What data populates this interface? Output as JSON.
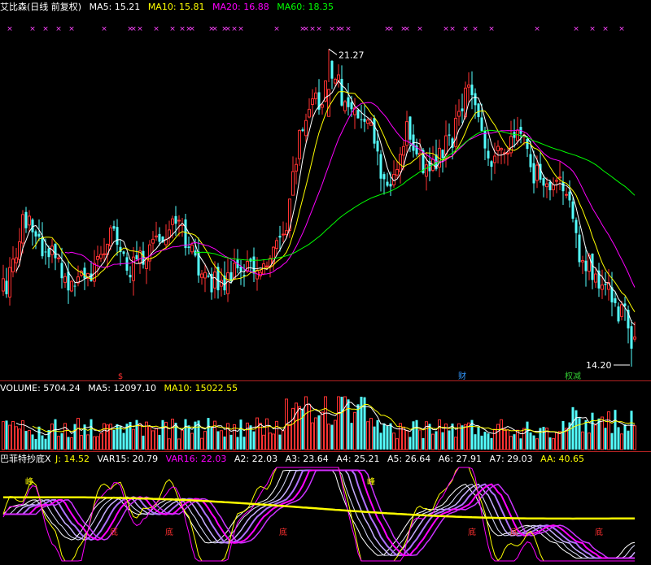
{
  "price_panel": {
    "title": "艾比森(日线 前复权)",
    "ma_labels": [
      {
        "text": "MA5: 15.21",
        "color": "#ffffff"
      },
      {
        "text": "MA10: 15.81",
        "color": "#ffff00"
      },
      {
        "text": "MA20: 16.88",
        "color": "#ff00ff"
      },
      {
        "text": "MA60: 18.35",
        "color": "#00ff00"
      }
    ],
    "high_annotation": "21.27",
    "low_annotation": "14.20",
    "event_markers": [
      {
        "label": "$",
        "color": "#ff3030",
        "x_index": 36
      },
      {
        "label": "财",
        "color": "#3399ff",
        "x_index": 141
      },
      {
        "label": "权减",
        "color": "#33cc33",
        "x_index": 175
      }
    ]
  },
  "volume_panel": {
    "labels": [
      {
        "text": "VOLUME: 5704.24",
        "color": "#ffffff"
      },
      {
        "text": "MA5: 12097.10",
        "color": "#ffffff"
      },
      {
        "text": "MA10: 15022.55",
        "color": "#ffff00"
      }
    ]
  },
  "indicator_panel": {
    "labels": [
      {
        "text": "巴菲特抄底X",
        "color": "#ffffff"
      },
      {
        "text": "J: 14.52",
        "color": "#ffff00"
      },
      {
        "text": "VAR15: 20.79",
        "color": "#ffffff"
      },
      {
        "text": "VAR16: 22.03",
        "color": "#ff00ff"
      },
      {
        "text": "A2: 22.03",
        "color": "#ffffff"
      },
      {
        "text": "A3: 23.64",
        "color": "#ffffff"
      },
      {
        "text": "A4: 25.21",
        "color": "#ffffff"
      },
      {
        "text": "A5: 26.64",
        "color": "#ffffff"
      },
      {
        "text": "A6: 27.91",
        "color": "#ffffff"
      },
      {
        "text": "A7: 29.03",
        "color": "#ffffff"
      },
      {
        "text": "AA: 40.65",
        "color": "#ffff00"
      }
    ],
    "signal_labels": [
      {
        "text": "峰",
        "x_index": 8,
        "color": "#ffff00"
      },
      {
        "text": "峰",
        "x_index": 113,
        "color": "#ffff00"
      },
      {
        "text": "底",
        "x_index": 34,
        "color": "#ff3030"
      },
      {
        "text": "底",
        "x_index": 51,
        "color": "#ff3030"
      },
      {
        "text": "底",
        "x_index": 86,
        "color": "#ff3030"
      },
      {
        "text": "底",
        "x_index": 144,
        "color": "#ff3030"
      },
      {
        "text": "底",
        "x_index": 157,
        "color": "#ff3030"
      },
      {
        "text": "底",
        "x_index": 183,
        "color": "#ff3030"
      }
    ]
  },
  "chart_data": {
    "type": "candlestick",
    "title": "艾比森(日线 前复权)",
    "y_range": [
      14.0,
      22.0
    ],
    "bar_count": 195,
    "anchors": [
      {
        "i": 0,
        "c": 16.0
      },
      {
        "i": 7,
        "c": 17.4
      },
      {
        "i": 12,
        "c": 16.9
      },
      {
        "i": 20,
        "c": 16.1
      },
      {
        "i": 27,
        "c": 16.3
      },
      {
        "i": 34,
        "c": 17.2
      },
      {
        "i": 40,
        "c": 16.4
      },
      {
        "i": 46,
        "c": 16.9
      },
      {
        "i": 54,
        "c": 17.3
      },
      {
        "i": 60,
        "c": 16.5
      },
      {
        "i": 66,
        "c": 16.0
      },
      {
        "i": 72,
        "c": 16.4
      },
      {
        "i": 80,
        "c": 16.3
      },
      {
        "i": 86,
        "c": 17.3
      },
      {
        "i": 92,
        "c": 19.5
      },
      {
        "i": 97,
        "c": 20.1
      },
      {
        "i": 100,
        "c": 20.9
      },
      {
        "i": 106,
        "c": 20.0
      },
      {
        "i": 112,
        "c": 19.7
      },
      {
        "i": 118,
        "c": 18.3
      },
      {
        "i": 124,
        "c": 19.4
      },
      {
        "i": 130,
        "c": 18.6
      },
      {
        "i": 136,
        "c": 19.1
      },
      {
        "i": 143,
        "c": 20.2
      },
      {
        "i": 150,
        "c": 18.9
      },
      {
        "i": 158,
        "c": 19.3
      },
      {
        "i": 164,
        "c": 18.5
      },
      {
        "i": 172,
        "c": 18.3
      },
      {
        "i": 178,
        "c": 16.6
      },
      {
        "i": 184,
        "c": 16.0
      },
      {
        "i": 190,
        "c": 15.4
      },
      {
        "i": 194,
        "c": 14.6
      }
    ],
    "high_point": {
      "i": 100,
      "value": 21.27
    },
    "low_point": {
      "i": 193,
      "value": 14.2
    },
    "ma_periods": [
      5,
      10,
      20,
      60
    ],
    "ma_colors": [
      "#ffffff",
      "#ffff00",
      "#ff00ff",
      "#00ff00"
    ]
  }
}
